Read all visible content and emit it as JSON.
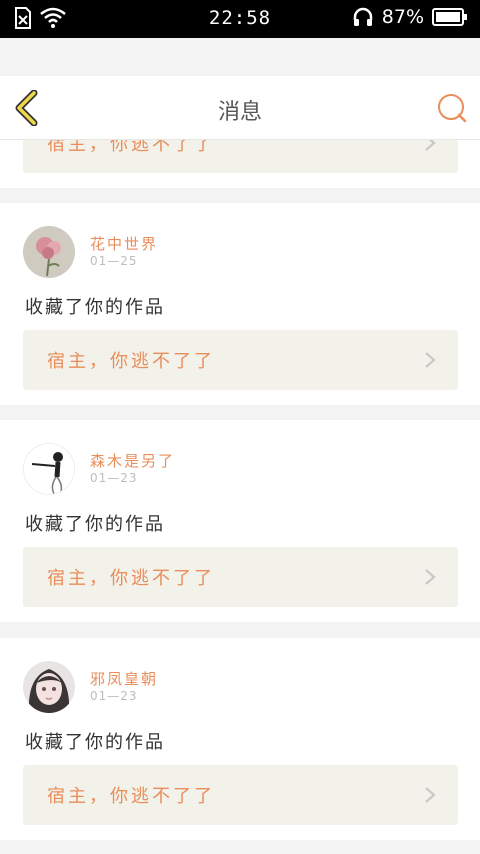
{
  "status_bar": {
    "time": "22:58",
    "battery_percent": "87%",
    "icons": [
      "sim-missing-icon",
      "wifi-icon",
      "headphones-icon",
      "battery-icon"
    ]
  },
  "nav": {
    "title": "消息",
    "back_icon": "chevron-left-icon",
    "search_icon": "search-icon"
  },
  "colors": {
    "accent": "#e98e5b",
    "back_icon_fill": "#f1d74a",
    "card_inner_bg": "#f2f1ea",
    "page_bg": "#f3f3f3"
  },
  "messages": [
    {
      "work_title": "宿主，你逃不了了"
    },
    {
      "username": "花中世界",
      "date": "01—25",
      "action": "收藏了你的作品",
      "work_title": "宿主，你逃不了了",
      "avatar": "flower-avatar"
    },
    {
      "username": "森木是另了",
      "date": "01—23",
      "action": "收藏了你的作品",
      "work_title": "宿主，你逃不了了",
      "avatar": "sketch-avatar"
    },
    {
      "username": "邪凤皇朝",
      "date": "01—23",
      "action": "收藏了你的作品",
      "work_title": "宿主，你逃不了了",
      "avatar": "anime-girl-avatar"
    }
  ]
}
